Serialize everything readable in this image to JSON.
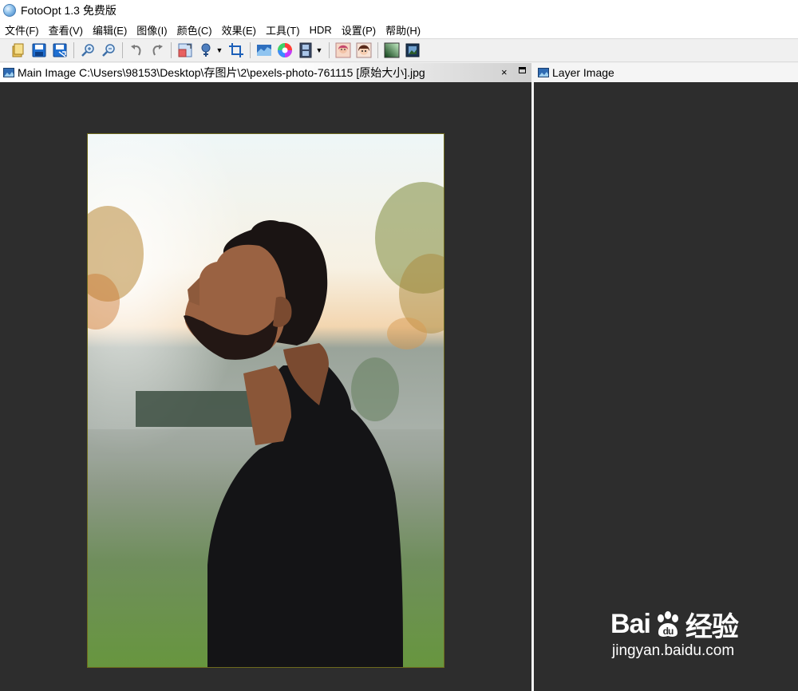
{
  "window": {
    "title": "FotoOpt 1.3 免费版"
  },
  "menu": [
    "文件(F)",
    "查看(V)",
    "编辑(E)",
    "图像(I)",
    "颜色(C)",
    "效果(E)",
    "工具(T)",
    "HDR",
    "设置(P)",
    "帮助(H)"
  ],
  "toolbar": {
    "buttons": [
      "open-icon",
      "save-icon",
      "save-as-icon",
      "zoom-in-icon",
      "zoom-out-icon",
      "undo-icon",
      "redo-icon",
      "resize-icon",
      "rotate-icon",
      "crop-icon",
      "levels-icon",
      "color-wheel-icon",
      "filmstrip-icon",
      "portrait-icon",
      "cartoon-icon",
      "gradient-icon",
      "frame-icon"
    ]
  },
  "tabs": {
    "main": {
      "label": "Main Image C:\\Users\\98153\\Desktop\\存图片\\2\\pexels-photo-761115 [原始大小].jpg",
      "close": "×"
    },
    "layer": {
      "label": "Layer Image"
    }
  },
  "colors": {
    "pane_background": "#2d2d2d",
    "photo_border": "#6e6a1d"
  },
  "watermark": {
    "brand_left": "Bai",
    "brand_right": "经验",
    "url": "jingyan.baidu.com"
  }
}
